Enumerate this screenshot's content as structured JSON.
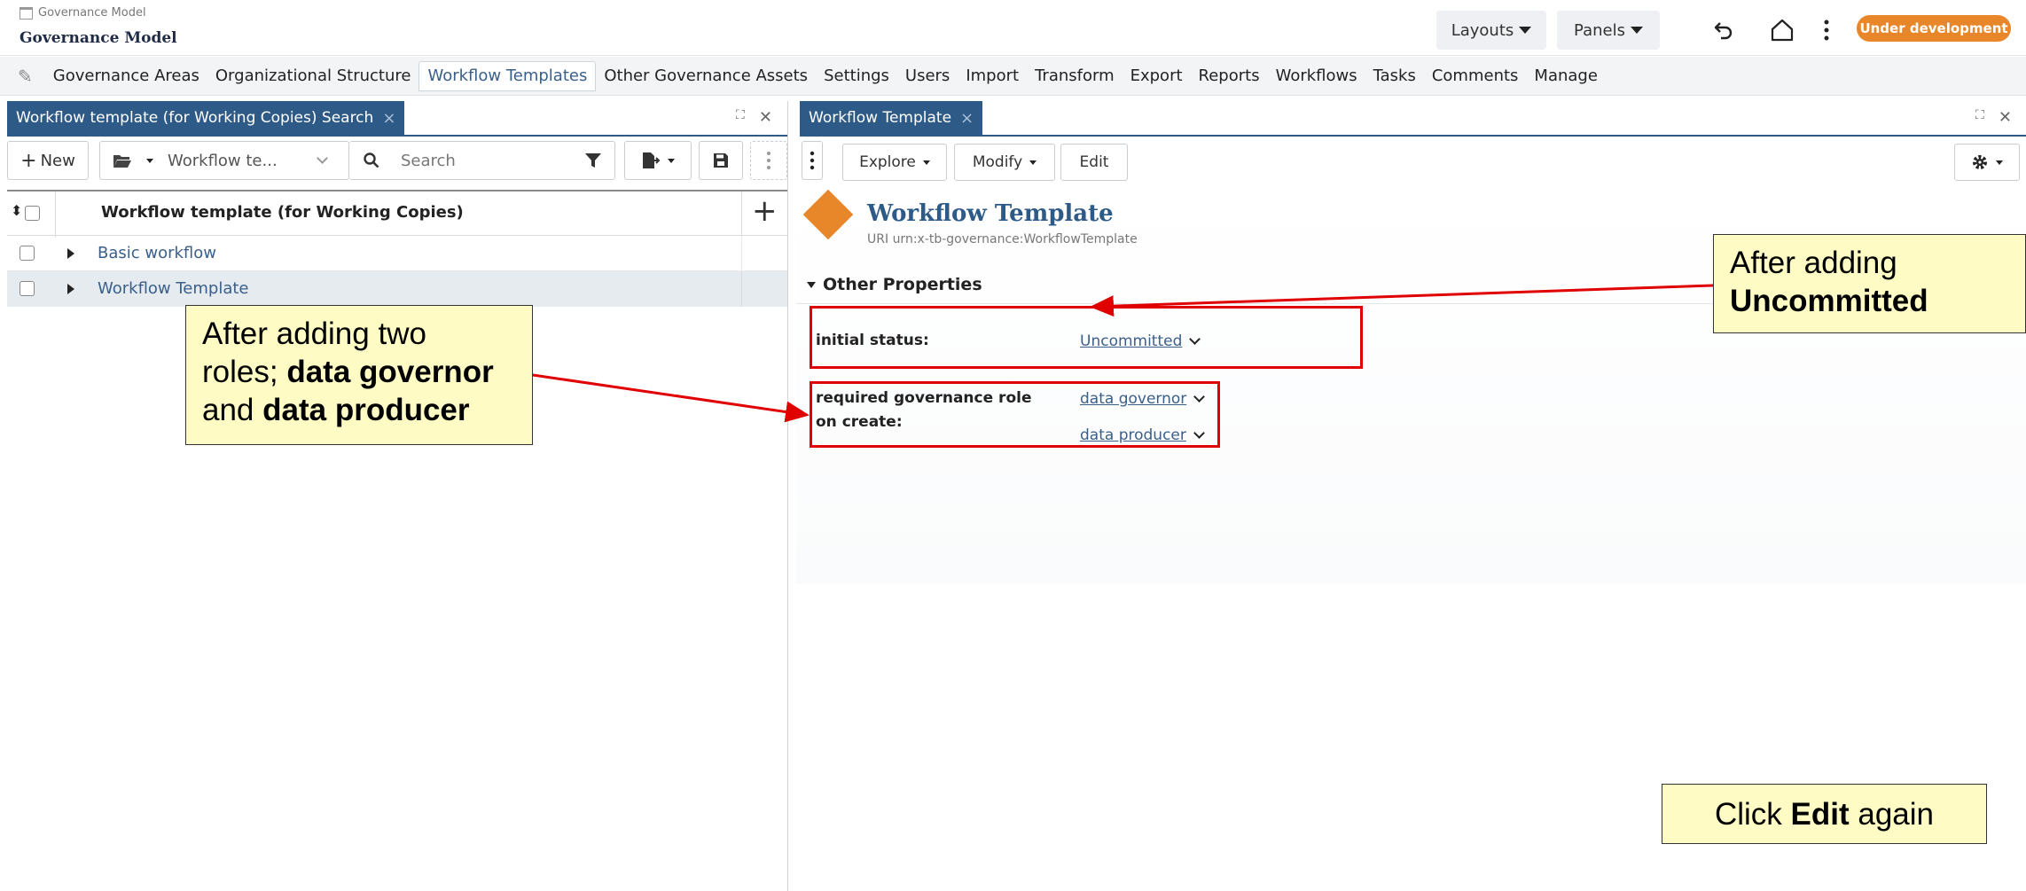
{
  "header": {
    "breadcrumb": "Governance Model",
    "app_title": "Governance Model",
    "layouts_label": "Layouts",
    "panels_label": "Panels",
    "status_badge": "Under development",
    "icons": [
      "bank-icon",
      "undo-icon",
      "home-icon",
      "more-vertical-icon"
    ]
  },
  "nav": {
    "items": [
      {
        "label": "Governance Areas"
      },
      {
        "label": "Organizational Structure"
      },
      {
        "label": "Workflow Templates",
        "active": true
      },
      {
        "label": "Other Governance Assets"
      },
      {
        "label": "Settings"
      },
      {
        "label": "Users"
      },
      {
        "label": "Import"
      },
      {
        "label": "Transform"
      },
      {
        "label": "Export"
      },
      {
        "label": "Reports"
      },
      {
        "label": "Workflows"
      },
      {
        "label": "Tasks"
      },
      {
        "label": "Comments"
      },
      {
        "label": "Manage"
      }
    ]
  },
  "left_panel": {
    "tab_label": "Workflow template (for Working Copies) Search",
    "new_label": "New",
    "class_select_value": "Workflow te...",
    "search_placeholder": "Search",
    "column_header": "Workflow template (for Working Copies)",
    "rows": [
      {
        "label": "Basic workflow"
      },
      {
        "label": "Workflow Template",
        "selected": true
      }
    ]
  },
  "right_panel": {
    "tab_label": "Workflow Template",
    "explore_label": "Explore",
    "modify_label": "Modify",
    "edit_label": "Edit",
    "resource_title": "Workflow Template",
    "uri_label": "URI",
    "uri_value": "urn:x-tb-governance:WorkflowTemplate",
    "section_title": "Other Properties",
    "properties": {
      "initial_status_label": "initial status:",
      "initial_status_value": "Uncommitted",
      "required_role_label_line1": "required governance role",
      "required_role_label_line2": "on create:",
      "required_role_values": [
        "data governor",
        "data producer"
      ]
    }
  },
  "annotations": {
    "uncommitted_line1": "After adding",
    "uncommitted_line2": "Uncommitted",
    "roles_line1": "After adding two",
    "roles_line2_pre": "roles; ",
    "roles_line2_bold": "data governor",
    "roles_line3_pre": "and ",
    "roles_line3_bold": "data producer",
    "edit_pre": "Click ",
    "edit_bold": "Edit",
    "edit_post": " again",
    "highlight_color": "#e00000",
    "callout_color": "#fffbc4"
  },
  "colors": {
    "accent": "#2e5a87",
    "status_badge": "#e8872a",
    "link": "#3a5f8a"
  }
}
